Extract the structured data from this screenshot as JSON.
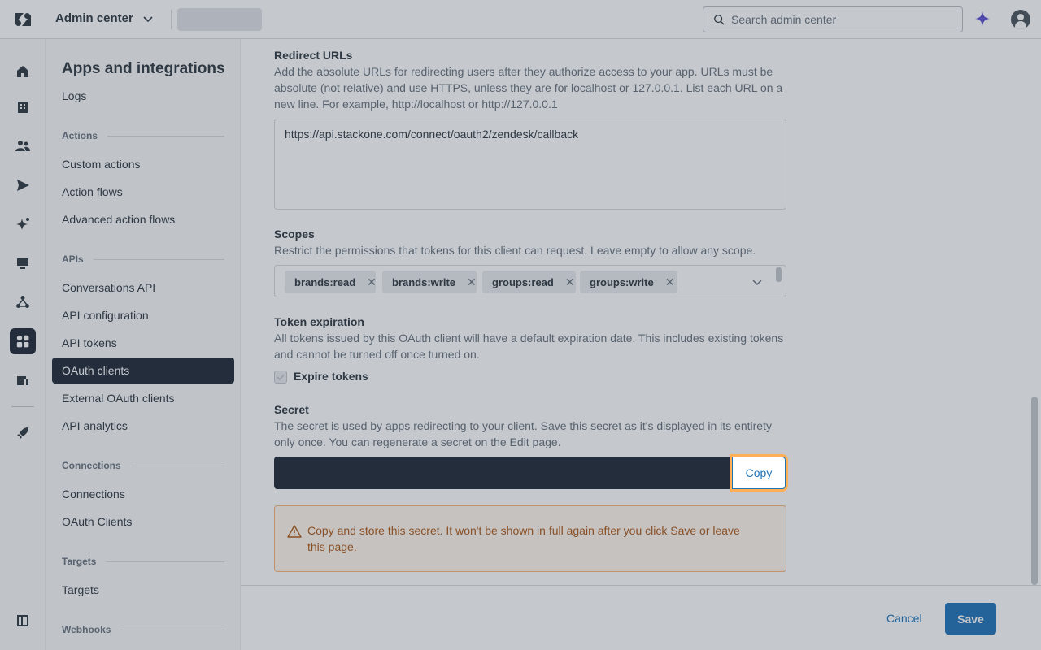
{
  "header": {
    "product": "Admin center",
    "search_placeholder": "Search admin center"
  },
  "nav": {
    "title": "Apps and integrations",
    "top_links": [
      "Logs"
    ],
    "groups": {
      "actions": {
        "label": "Actions",
        "items": [
          "Custom actions",
          "Action flows",
          "Advanced action flows"
        ]
      },
      "apis": {
        "label": "APIs",
        "items": [
          "Conversations API",
          "API configuration",
          "API tokens",
          "OAuth clients",
          "External OAuth clients",
          "API analytics"
        ]
      },
      "connections": {
        "label": "Connections",
        "items": [
          "Connections",
          "OAuth Clients"
        ]
      },
      "targets": {
        "label": "Targets",
        "items": [
          "Targets"
        ]
      },
      "webhooks": {
        "label": "Webhooks"
      }
    },
    "active_item": "OAuth clients"
  },
  "form": {
    "redirect": {
      "label": "Redirect URLs",
      "hint": "Add the absolute URLs for redirecting users after they authorize access to your app. URLs must be absolute (not relative) and use HTTPS, unless they are for localhost or 127.0.0.1. List each URL on a new line. For example, http://localhost or http://127.0.0.1",
      "value": "https://api.stackone.com/connect/oauth2/zendesk/callback"
    },
    "scopes": {
      "label": "Scopes",
      "hint": "Restrict the permissions that tokens for this client can request. Leave empty to allow any scope.",
      "tags": [
        "brands:read",
        "brands:write",
        "groups:read",
        "groups:write"
      ]
    },
    "token_expiration": {
      "label": "Token expiration",
      "hint": "All tokens issued by this OAuth client will have a default expiration date. This includes existing tokens and cannot be turned off once turned on.",
      "checkbox_label": "Expire tokens",
      "checked": true
    },
    "secret": {
      "label": "Secret",
      "hint": "The secret is used by apps redirecting to your client. Save this secret as it's displayed in its entirety only once. You can regenerate a secret on the Edit page.",
      "copy_label": "Copy",
      "warning": "Copy and store this secret. It won't be shown in full again after you click Save or leave this page."
    }
  },
  "footer": {
    "cancel_label": "Cancel",
    "save_label": "Save"
  },
  "colors": {
    "accent": "#1f73b7",
    "nav_active": "#1f2937",
    "focus_ring": "#ffb057",
    "warning_text": "#ad5918"
  }
}
